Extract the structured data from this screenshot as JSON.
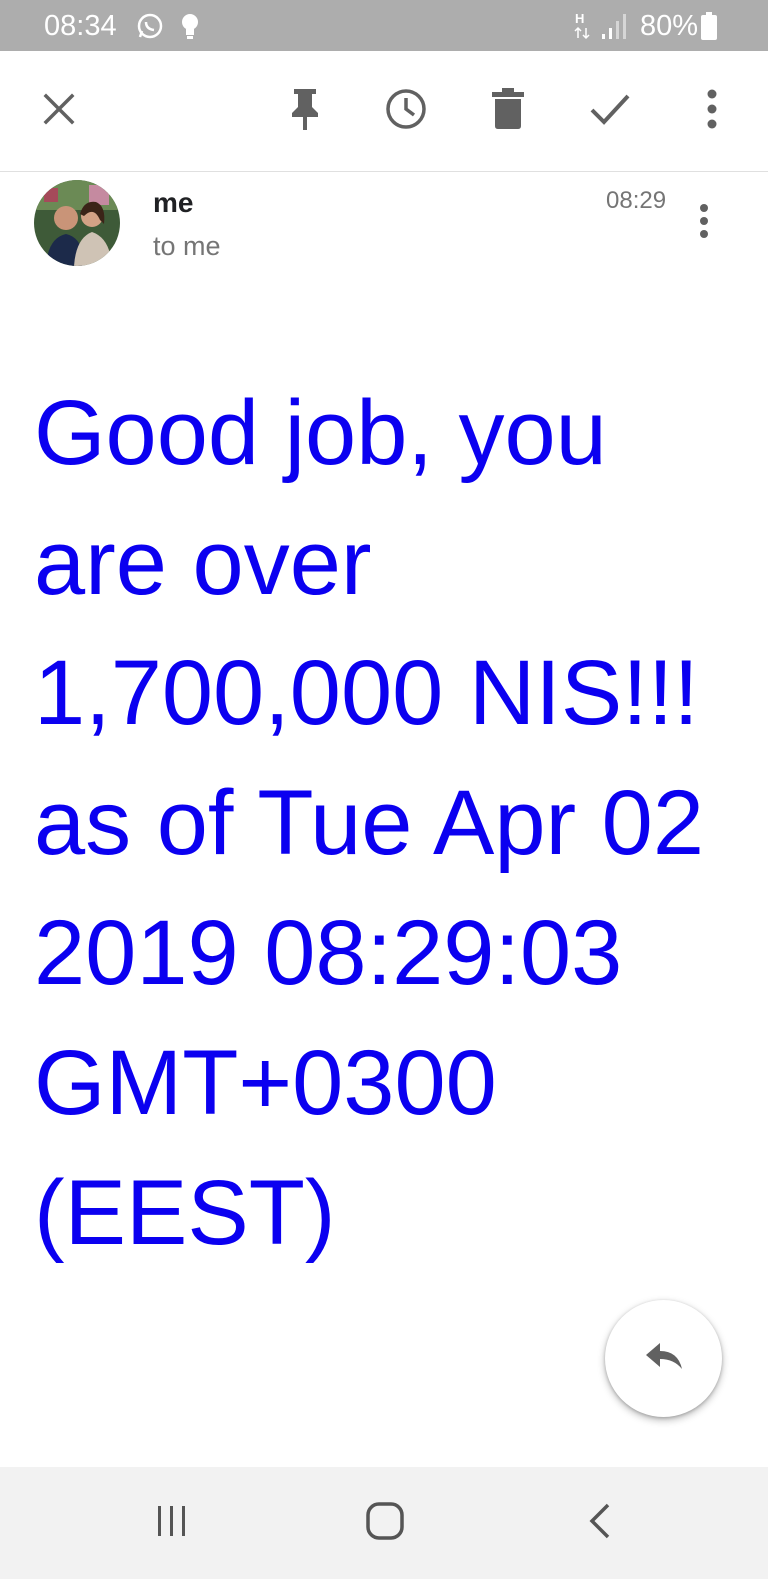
{
  "status_bar": {
    "time": "08:34",
    "battery": "80%",
    "icons": [
      "whatsapp-icon",
      "bulb-icon",
      "hplus-icon",
      "signal-icon",
      "battery-icon"
    ]
  },
  "toolbar": {
    "icons": [
      "close-icon",
      "pin-icon",
      "snooze-icon",
      "delete-icon",
      "done-icon",
      "more-vert-icon"
    ]
  },
  "message": {
    "sender": "me",
    "recipient": "to me",
    "time": "08:29",
    "body": "Good job, you are over 1,700,000 NIS!!! as of Tue Apr 02 2019 08:29:03 GMT+0300 (EEST)"
  },
  "fab": {
    "icon": "reply-icon"
  },
  "nav": {
    "icons": [
      "recent-apps-icon",
      "home-icon",
      "back-icon"
    ]
  },
  "colors": {
    "status_bar_bg": "#adadad",
    "body_text": "#0b00f0",
    "icon_gray": "#616161",
    "nav_bg": "#f2f2f2"
  }
}
